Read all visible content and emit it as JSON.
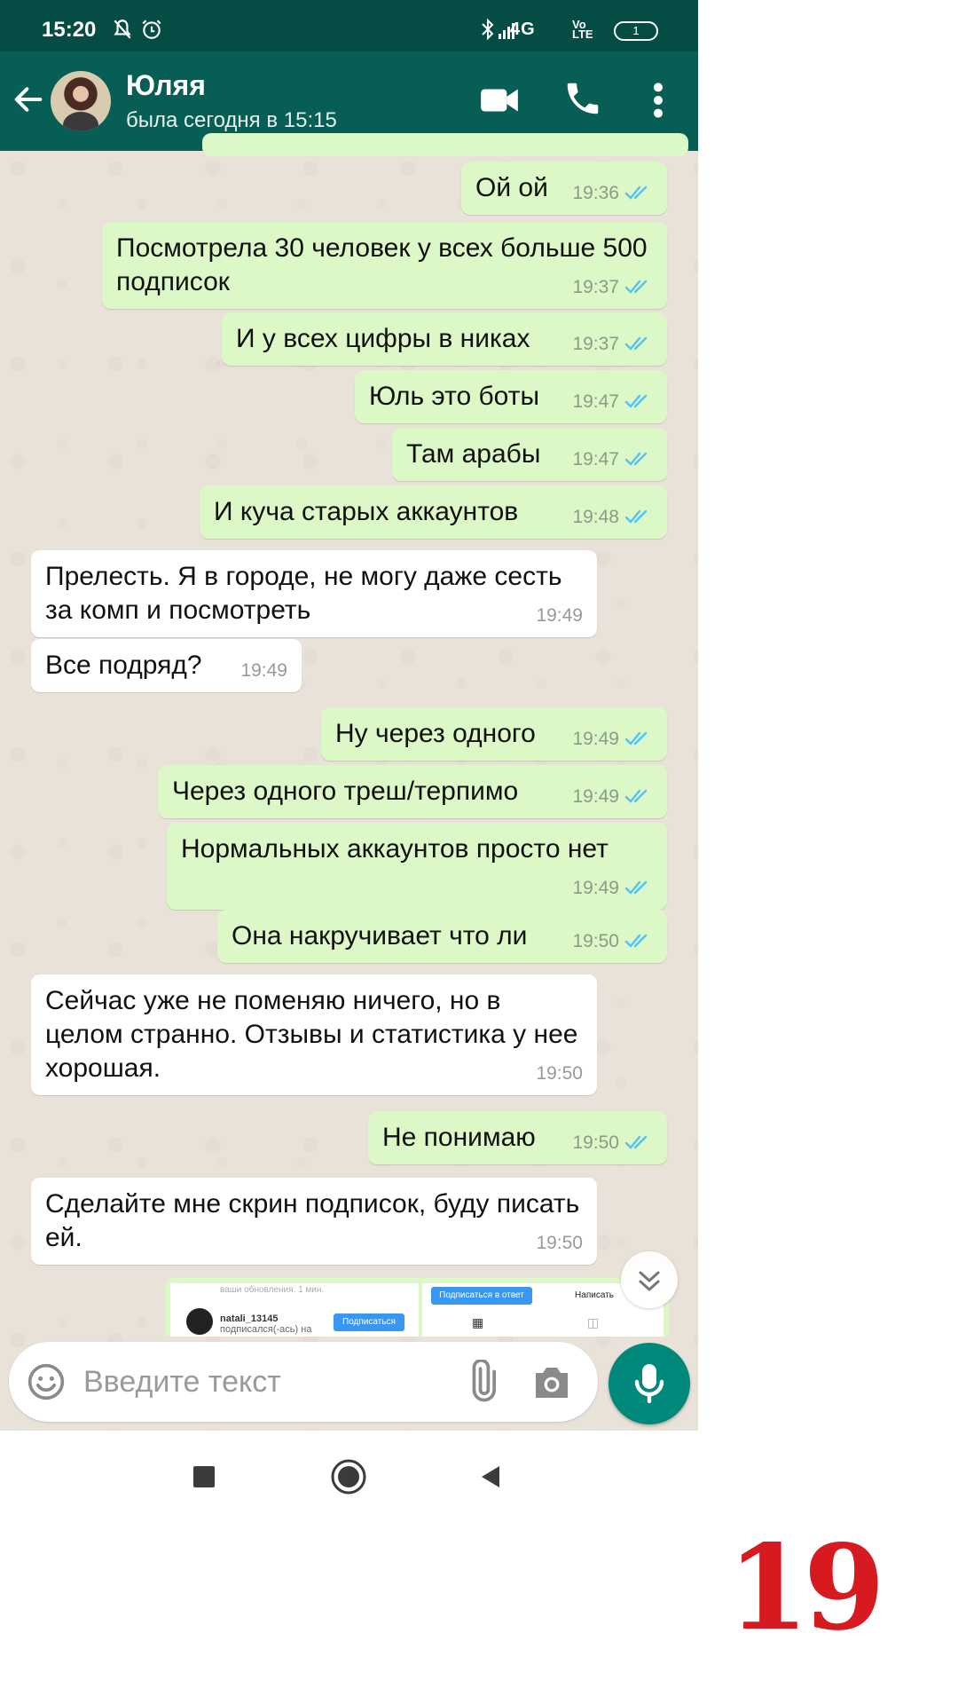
{
  "status_bar": {
    "time": "15:20",
    "network": "4G",
    "volte": "Vo LTE",
    "battery": "1"
  },
  "header": {
    "contact_name": "Юляя",
    "last_seen": "была сегодня в 15:15"
  },
  "messages": [
    {
      "dir": "out",
      "text": "Ой ой",
      "time": "19:36"
    },
    {
      "dir": "out",
      "text": "Посмотрела 30 человек у всех больше 500 подписок",
      "time": "19:37"
    },
    {
      "dir": "out",
      "text": "И у всех цифры в никах",
      "time": "19:37"
    },
    {
      "dir": "out",
      "text": "Юль это боты",
      "time": "19:47"
    },
    {
      "dir": "out",
      "text": "Там арабы",
      "time": "19:47"
    },
    {
      "dir": "out",
      "text": "И куча старых аккаунтов",
      "time": "19:48"
    },
    {
      "dir": "in",
      "text": "Прелесть. Я в городе, не могу даже сесть за комп и посмотреть",
      "time": "19:49"
    },
    {
      "dir": "in",
      "text": "Все подряд?",
      "time": "19:49"
    },
    {
      "dir": "out",
      "text": "Ну через одного",
      "time": "19:49"
    },
    {
      "dir": "out",
      "text": "Через одного треш/терпимо",
      "time": "19:49"
    },
    {
      "dir": "out",
      "text": "Нормальных аккаунтов просто нет",
      "time": "19:49"
    },
    {
      "dir": "out",
      "text": "Она накручивает что ли",
      "time": "19:50"
    },
    {
      "dir": "in",
      "text": "Сейчас уже не поменяю ничего, но в целом странно. Отзывы и статистика у нее хорошая.",
      "time": "19:50"
    },
    {
      "dir": "out",
      "text": "Не понимаю",
      "time": "19:50"
    },
    {
      "dir": "in",
      "text": "Сделайте мне скрин подписок, буду писать ей.",
      "time": "19:50"
    }
  ],
  "image_message": {
    "header_text": "ваши обновления. 1 мин.",
    "username": "natali_13145",
    "action_text": "подписался(-ась) на",
    "subscribe_button": "Подписаться",
    "follow_back_button": "Подписаться в ответ",
    "write_button": "Написать"
  },
  "composer": {
    "placeholder": "Введите текст"
  },
  "page_number": "19",
  "colors": {
    "header": "#075e54",
    "status_bar": "#054d44",
    "outgoing_bubble": "#dcf8c6",
    "incoming_bubble": "#ffffff",
    "read_ticks": "#4fc3f7",
    "mic_button": "#00897b",
    "page_number": "#d71920"
  },
  "icons": [
    "back-arrow-icon",
    "video-call-icon",
    "phone-icon",
    "more-vert-icon",
    "emoji-icon",
    "attach-icon",
    "camera-icon",
    "mic-icon",
    "scroll-down-icon",
    "nav-recents-icon",
    "nav-home-icon",
    "nav-back-icon"
  ]
}
